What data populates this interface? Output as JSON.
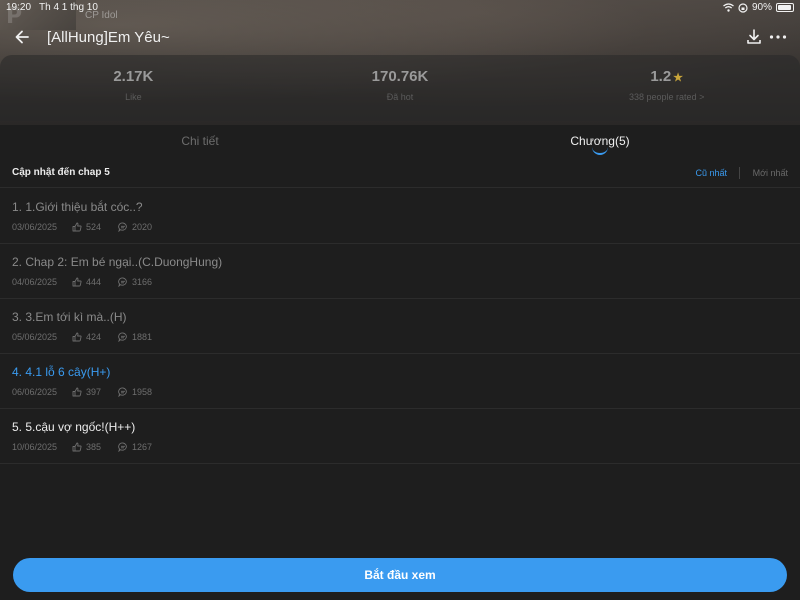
{
  "status_bar": {
    "time": "19:20",
    "date": "Th 4 1 thg 10",
    "battery": "90%"
  },
  "cover_label": "CP Idol",
  "header": {
    "title": "[AllHung]Em Yêu~"
  },
  "stats": [
    {
      "value": "2.17K",
      "label": "Like"
    },
    {
      "value": "170.76K",
      "label": "Đã hot"
    },
    {
      "value": "1.2",
      "label": "338 people rated >"
    }
  ],
  "tabs": [
    {
      "label": "Chi tiết"
    },
    {
      "label": "Chương(5)"
    }
  ],
  "update_info": {
    "text": "Cập nhật đến chap 5",
    "sort_oldest": "Cũ nhất",
    "sort_newest": "Mới nhất"
  },
  "chapters": [
    {
      "title": "1. 1.Giới thiệu bắt cóc..?",
      "date": "03/06/2025",
      "likes": "524",
      "comments": "2020"
    },
    {
      "title": "2. Chap 2: Em bé ngại..(C.DuongHung)",
      "date": "04/06/2025",
      "likes": "444",
      "comments": "3166"
    },
    {
      "title": "3. 3.Em tới kì mà..(H)",
      "date": "05/06/2025",
      "likes": "424",
      "comments": "1881"
    },
    {
      "title": "4. 4.1 lỗ 6 cây(H+)",
      "date": "06/06/2025",
      "likes": "397",
      "comments": "1958"
    },
    {
      "title": "5. 5.cậu vợ ngốc!(H++)",
      "date": "10/06/2025",
      "likes": "385",
      "comments": "1267"
    }
  ],
  "start_button": "Bắt đầu xem",
  "colors": {
    "accent": "#3a9bf0",
    "background": "#1e1e1e",
    "star": "#c9a53a"
  }
}
